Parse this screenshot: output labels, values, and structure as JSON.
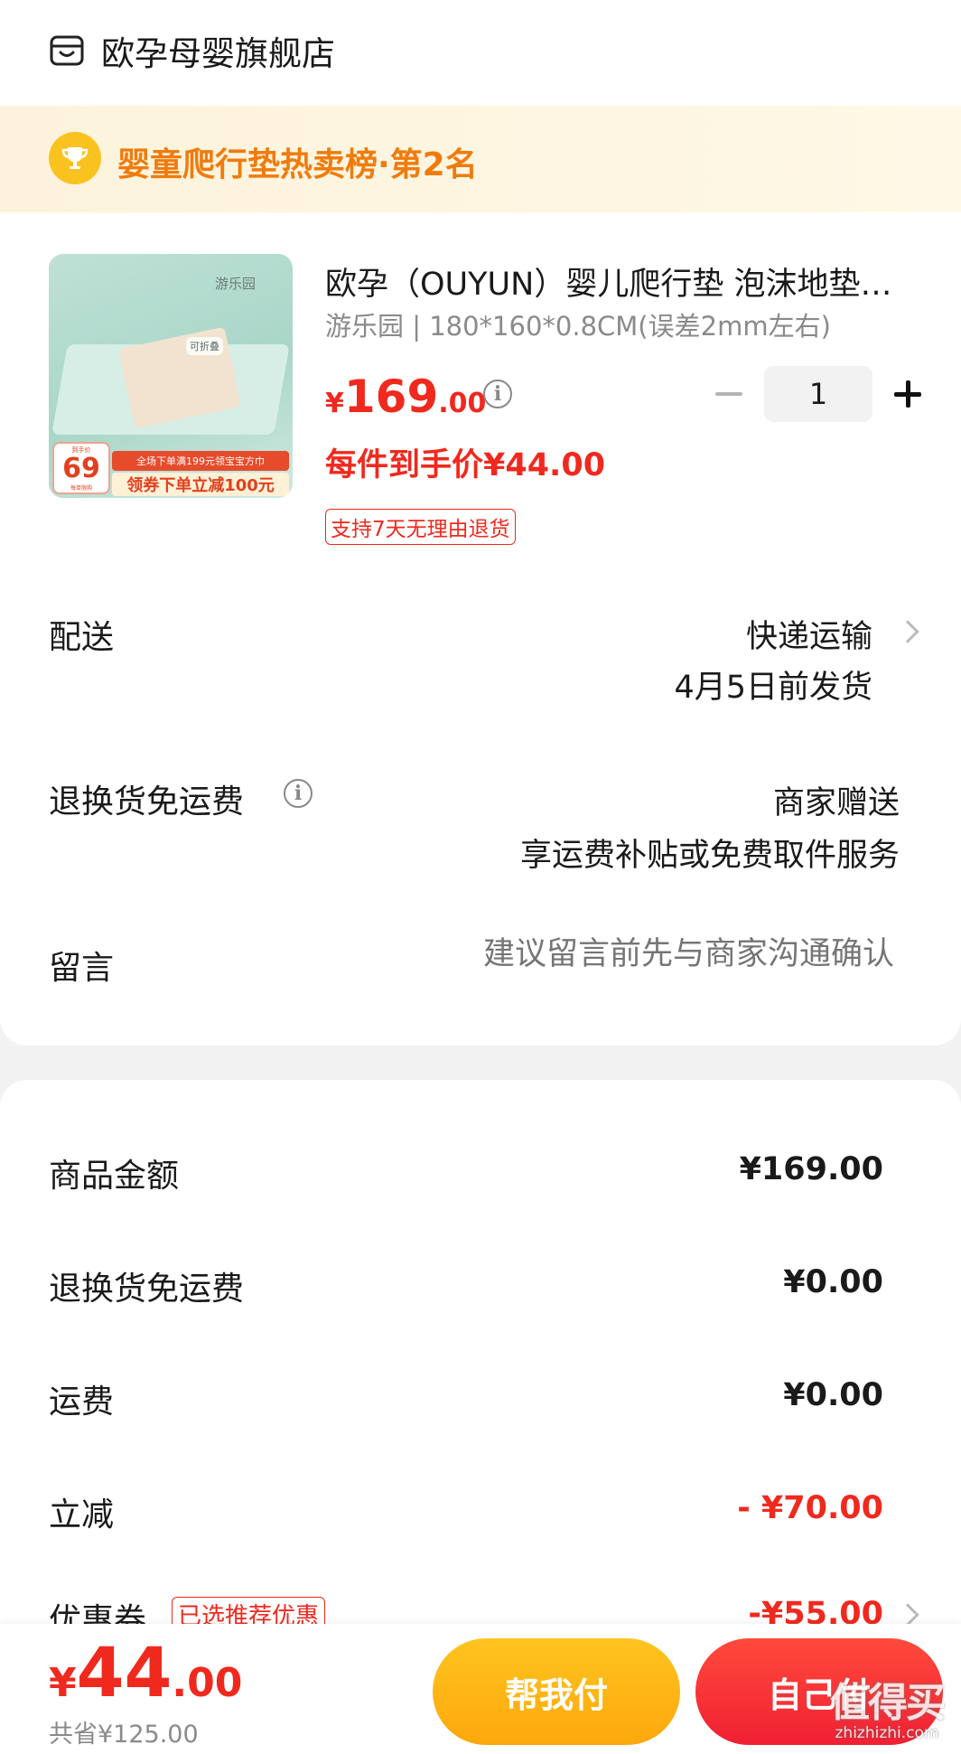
{
  "shop": {
    "name": "欧孕母婴旗舰店"
  },
  "rank_banner": {
    "text": "婴童爬行垫热卖榜·第2名"
  },
  "product": {
    "title": "欧孕（OUYUN）婴儿爬行垫 泡沫地垫宝宝爬爬垫",
    "spec": "游乐园 | 180*160*0.8CM(误差2mm左右)",
    "price_currency": "¥",
    "price_int": "169",
    "price_dec": ".00",
    "quantity": "1",
    "unit_price": "每件到手价¥44.00",
    "return_tag": "支持7天无理由退货",
    "image": {
      "logo": "游乐园",
      "fold_label": "可折叠",
      "promo_line1": "全场下单满199元领宝宝方巾",
      "promo_line2": "领券下单立减100元",
      "badge_top": "到手价",
      "badge_price": "69",
      "badge_bottom": "每单限购"
    }
  },
  "delivery": {
    "label": "配送",
    "method": "快递运输",
    "ship_date": "4月5日前发货"
  },
  "return_shipping": {
    "label": "退换货免运费",
    "value": "商家赠送",
    "desc": "享运费补贴或免费取件服务"
  },
  "message": {
    "label": "留言",
    "placeholder": "建议留言前先与商家沟通确认"
  },
  "summary": {
    "rows": [
      {
        "label": "商品金额",
        "value": "¥169.00"
      },
      {
        "label": "退换货免运费",
        "value": "¥0.00"
      },
      {
        "label": "运费",
        "value": "¥0.00"
      },
      {
        "label": "立减",
        "value": "- ¥70.00"
      },
      {
        "label": "优惠券",
        "value": "-¥55.00"
      }
    ],
    "coupon_tag": "已选推荐优惠"
  },
  "bottom": {
    "total_currency": "¥",
    "total_int": "44",
    "total_dec": ".00",
    "saved": "共省¥125.00",
    "help_pay_label": "帮我付",
    "self_pay_label": "自己付"
  },
  "watermark": {
    "big": "值得买",
    "small": "zhizhizhi.com"
  },
  "colors": {
    "price_red": "#f0291e",
    "rank_orange": "#f07b0c",
    "help_btn": "#fdb514",
    "pay_btn": "#f5283a"
  }
}
